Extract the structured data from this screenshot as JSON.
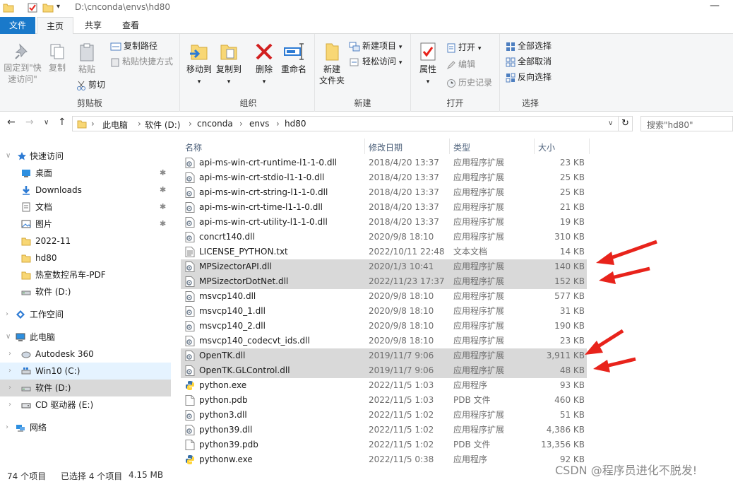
{
  "window": {
    "path": "D:\\cnconda\\envs\\hd80",
    "minimize": "—"
  },
  "ribbon_tabs": {
    "file": "文件",
    "home": "主页",
    "share": "共享",
    "view": "查看"
  },
  "clipboard": {
    "pin_quick": "固定到\"快",
    "pin_quick2": "速访问\"",
    "copy": "复制",
    "paste": "粘贴",
    "copy_path": "复制路径",
    "paste_shortcut": "粘贴快捷方式",
    "cut": "剪切",
    "group": "剪贴板"
  },
  "organize": {
    "move_to": "移动到",
    "copy_to": "复制到",
    "delete": "删除",
    "rename": "重命名",
    "group": "组织"
  },
  "new": {
    "new_folder": "新建",
    "new_folder2": "文件夹",
    "new_item": "新建项目",
    "easy_access": "轻松访问",
    "group": "新建"
  },
  "open": {
    "properties": "属性",
    "open": "打开",
    "edit": "编辑",
    "history": "历史记录",
    "group": "打开"
  },
  "select": {
    "select_all": "全部选择",
    "select_none": "全部取消",
    "invert": "反向选择",
    "group": "选择"
  },
  "breadcrumb": [
    "此电脑",
    "软件 (D:)",
    "cnconda",
    "envs",
    "hd80"
  ],
  "search": {
    "placeholder": "搜索\"hd80\""
  },
  "sidebar": {
    "quick_access": "快速访问",
    "desktop": "桌面",
    "downloads": "Downloads",
    "documents": "文档",
    "pictures": "图片",
    "f2022": "2022-11",
    "hd80": "hd80",
    "pdf": "热室数控吊车-PDF",
    "drive_d_quick": "软件 (D:)",
    "workspace": "工作空间",
    "this_pc": "此电脑",
    "autodesk": "Autodesk 360",
    "win10": "Win10 (C:)",
    "drive_d": "软件 (D:)",
    "cd": "CD 驱动器 (E:)",
    "network": "网络"
  },
  "columns": {
    "name": "名称",
    "date": "修改日期",
    "type": "类型",
    "size": "大小"
  },
  "files": [
    {
      "name": "api-ms-win-crt-runtime-l1-1-0.dll",
      "date": "2018/4/20 13:37",
      "type": "应用程序扩展",
      "size": "23 KB",
      "icon": "dll",
      "selected": false
    },
    {
      "name": "api-ms-win-crt-stdio-l1-1-0.dll",
      "date": "2018/4/20 13:37",
      "type": "应用程序扩展",
      "size": "25 KB",
      "icon": "dll",
      "selected": false
    },
    {
      "name": "api-ms-win-crt-string-l1-1-0.dll",
      "date": "2018/4/20 13:37",
      "type": "应用程序扩展",
      "size": "25 KB",
      "icon": "dll",
      "selected": false
    },
    {
      "name": "api-ms-win-crt-time-l1-1-0.dll",
      "date": "2018/4/20 13:37",
      "type": "应用程序扩展",
      "size": "21 KB",
      "icon": "dll",
      "selected": false
    },
    {
      "name": "api-ms-win-crt-utility-l1-1-0.dll",
      "date": "2018/4/20 13:37",
      "type": "应用程序扩展",
      "size": "19 KB",
      "icon": "dll",
      "selected": false
    },
    {
      "name": "concrt140.dll",
      "date": "2020/9/8 18:10",
      "type": "应用程序扩展",
      "size": "310 KB",
      "icon": "dll",
      "selected": false
    },
    {
      "name": "LICENSE_PYTHON.txt",
      "date": "2022/10/11 22:48",
      "type": "文本文档",
      "size": "14 KB",
      "icon": "txt",
      "selected": false
    },
    {
      "name": "MPSizectorAPI.dll",
      "date": "2020/1/3 10:41",
      "type": "应用程序扩展",
      "size": "140 KB",
      "icon": "dll",
      "selected": true
    },
    {
      "name": "MPSizectorDotNet.dll",
      "date": "2022/11/23 17:37",
      "type": "应用程序扩展",
      "size": "152 KB",
      "icon": "dll",
      "selected": true
    },
    {
      "name": "msvcp140.dll",
      "date": "2020/9/8 18:10",
      "type": "应用程序扩展",
      "size": "577 KB",
      "icon": "dll",
      "selected": false
    },
    {
      "name": "msvcp140_1.dll",
      "date": "2020/9/8 18:10",
      "type": "应用程序扩展",
      "size": "31 KB",
      "icon": "dll",
      "selected": false
    },
    {
      "name": "msvcp140_2.dll",
      "date": "2020/9/8 18:10",
      "type": "应用程序扩展",
      "size": "190 KB",
      "icon": "dll",
      "selected": false
    },
    {
      "name": "msvcp140_codecvt_ids.dll",
      "date": "2020/9/8 18:10",
      "type": "应用程序扩展",
      "size": "23 KB",
      "icon": "dll",
      "selected": false
    },
    {
      "name": "OpenTK.dll",
      "date": "2019/11/7 9:06",
      "type": "应用程序扩展",
      "size": "3,911 KB",
      "icon": "dll",
      "selected": true
    },
    {
      "name": "OpenTK.GLControl.dll",
      "date": "2019/11/7 9:06",
      "type": "应用程序扩展",
      "size": "48 KB",
      "icon": "dll",
      "selected": true
    },
    {
      "name": "python.exe",
      "date": "2022/11/5 1:03",
      "type": "应用程序",
      "size": "93 KB",
      "icon": "exe",
      "selected": false
    },
    {
      "name": "python.pdb",
      "date": "2022/11/5 1:03",
      "type": "PDB 文件",
      "size": "460 KB",
      "icon": "blank",
      "selected": false
    },
    {
      "name": "python3.dll",
      "date": "2022/11/5 1:02",
      "type": "应用程序扩展",
      "size": "51 KB",
      "icon": "dll",
      "selected": false
    },
    {
      "name": "python39.dll",
      "date": "2022/11/5 1:02",
      "type": "应用程序扩展",
      "size": "4,386 KB",
      "icon": "dll",
      "selected": false
    },
    {
      "name": "python39.pdb",
      "date": "2022/11/5 1:02",
      "type": "PDB 文件",
      "size": "13,356 KB",
      "icon": "blank",
      "selected": false
    },
    {
      "name": "pythonw.exe",
      "date": "2022/11/5 0:38",
      "type": "应用程序",
      "size": "92 KB",
      "icon": "exe",
      "selected": false
    }
  ],
  "status": {
    "count": "74 个项目",
    "selected": "已选择 4 个项目",
    "size": "4.15 MB"
  },
  "watermark": "CSDN @程序员进化不脱发!",
  "colors": {
    "accent": "#1979ca",
    "selection": "#d9d9d9",
    "arrow": "#e8231b",
    "folder": "#f8d775"
  }
}
